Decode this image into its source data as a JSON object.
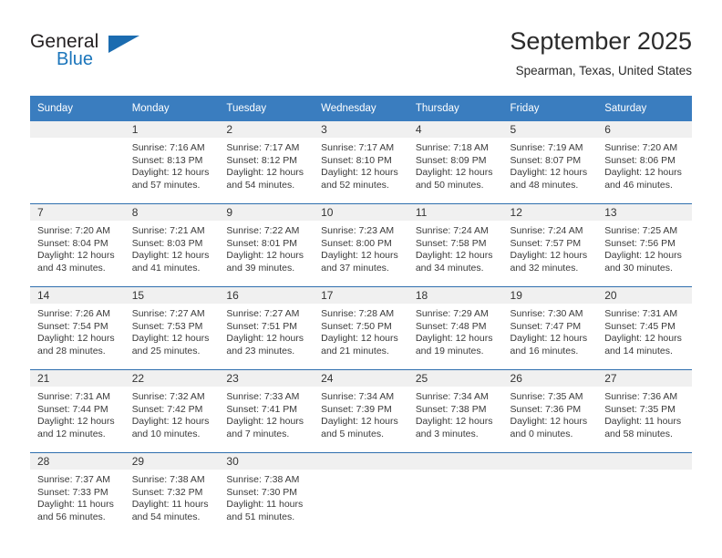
{
  "brand": {
    "name_part1": "General",
    "name_part2": "Blue",
    "accent_color": "#1b6cb0"
  },
  "header": {
    "title": "September 2025",
    "subtitle": "Spearman, Texas, United States"
  },
  "calendar": {
    "header_bg": "#3a7dbf",
    "daynum_bg": "#f0f0f0",
    "weekday_headers": [
      "Sunday",
      "Monday",
      "Tuesday",
      "Wednesday",
      "Thursday",
      "Friday",
      "Saturday"
    ],
    "weeks": [
      [
        {
          "day": "",
          "line1": "",
          "line2": "",
          "line3": "",
          "line4": ""
        },
        {
          "day": "1",
          "line1": "Sunrise: 7:16 AM",
          "line2": "Sunset: 8:13 PM",
          "line3": "Daylight: 12 hours",
          "line4": "and 57 minutes."
        },
        {
          "day": "2",
          "line1": "Sunrise: 7:17 AM",
          "line2": "Sunset: 8:12 PM",
          "line3": "Daylight: 12 hours",
          "line4": "and 54 minutes."
        },
        {
          "day": "3",
          "line1": "Sunrise: 7:17 AM",
          "line2": "Sunset: 8:10 PM",
          "line3": "Daylight: 12 hours",
          "line4": "and 52 minutes."
        },
        {
          "day": "4",
          "line1": "Sunrise: 7:18 AM",
          "line2": "Sunset: 8:09 PM",
          "line3": "Daylight: 12 hours",
          "line4": "and 50 minutes."
        },
        {
          "day": "5",
          "line1": "Sunrise: 7:19 AM",
          "line2": "Sunset: 8:07 PM",
          "line3": "Daylight: 12 hours",
          "line4": "and 48 minutes."
        },
        {
          "day": "6",
          "line1": "Sunrise: 7:20 AM",
          "line2": "Sunset: 8:06 PM",
          "line3": "Daylight: 12 hours",
          "line4": "and 46 minutes."
        }
      ],
      [
        {
          "day": "7",
          "line1": "Sunrise: 7:20 AM",
          "line2": "Sunset: 8:04 PM",
          "line3": "Daylight: 12 hours",
          "line4": "and 43 minutes."
        },
        {
          "day": "8",
          "line1": "Sunrise: 7:21 AM",
          "line2": "Sunset: 8:03 PM",
          "line3": "Daylight: 12 hours",
          "line4": "and 41 minutes."
        },
        {
          "day": "9",
          "line1": "Sunrise: 7:22 AM",
          "line2": "Sunset: 8:01 PM",
          "line3": "Daylight: 12 hours",
          "line4": "and 39 minutes."
        },
        {
          "day": "10",
          "line1": "Sunrise: 7:23 AM",
          "line2": "Sunset: 8:00 PM",
          "line3": "Daylight: 12 hours",
          "line4": "and 37 minutes."
        },
        {
          "day": "11",
          "line1": "Sunrise: 7:24 AM",
          "line2": "Sunset: 7:58 PM",
          "line3": "Daylight: 12 hours",
          "line4": "and 34 minutes."
        },
        {
          "day": "12",
          "line1": "Sunrise: 7:24 AM",
          "line2": "Sunset: 7:57 PM",
          "line3": "Daylight: 12 hours",
          "line4": "and 32 minutes."
        },
        {
          "day": "13",
          "line1": "Sunrise: 7:25 AM",
          "line2": "Sunset: 7:56 PM",
          "line3": "Daylight: 12 hours",
          "line4": "and 30 minutes."
        }
      ],
      [
        {
          "day": "14",
          "line1": "Sunrise: 7:26 AM",
          "line2": "Sunset: 7:54 PM",
          "line3": "Daylight: 12 hours",
          "line4": "and 28 minutes."
        },
        {
          "day": "15",
          "line1": "Sunrise: 7:27 AM",
          "line2": "Sunset: 7:53 PM",
          "line3": "Daylight: 12 hours",
          "line4": "and 25 minutes."
        },
        {
          "day": "16",
          "line1": "Sunrise: 7:27 AM",
          "line2": "Sunset: 7:51 PM",
          "line3": "Daylight: 12 hours",
          "line4": "and 23 minutes."
        },
        {
          "day": "17",
          "line1": "Sunrise: 7:28 AM",
          "line2": "Sunset: 7:50 PM",
          "line3": "Daylight: 12 hours",
          "line4": "and 21 minutes."
        },
        {
          "day": "18",
          "line1": "Sunrise: 7:29 AM",
          "line2": "Sunset: 7:48 PM",
          "line3": "Daylight: 12 hours",
          "line4": "and 19 minutes."
        },
        {
          "day": "19",
          "line1": "Sunrise: 7:30 AM",
          "line2": "Sunset: 7:47 PM",
          "line3": "Daylight: 12 hours",
          "line4": "and 16 minutes."
        },
        {
          "day": "20",
          "line1": "Sunrise: 7:31 AM",
          "line2": "Sunset: 7:45 PM",
          "line3": "Daylight: 12 hours",
          "line4": "and 14 minutes."
        }
      ],
      [
        {
          "day": "21",
          "line1": "Sunrise: 7:31 AM",
          "line2": "Sunset: 7:44 PM",
          "line3": "Daylight: 12 hours",
          "line4": "and 12 minutes."
        },
        {
          "day": "22",
          "line1": "Sunrise: 7:32 AM",
          "line2": "Sunset: 7:42 PM",
          "line3": "Daylight: 12 hours",
          "line4": "and 10 minutes."
        },
        {
          "day": "23",
          "line1": "Sunrise: 7:33 AM",
          "line2": "Sunset: 7:41 PM",
          "line3": "Daylight: 12 hours",
          "line4": "and 7 minutes."
        },
        {
          "day": "24",
          "line1": "Sunrise: 7:34 AM",
          "line2": "Sunset: 7:39 PM",
          "line3": "Daylight: 12 hours",
          "line4": "and 5 minutes."
        },
        {
          "day": "25",
          "line1": "Sunrise: 7:34 AM",
          "line2": "Sunset: 7:38 PM",
          "line3": "Daylight: 12 hours",
          "line4": "and 3 minutes."
        },
        {
          "day": "26",
          "line1": "Sunrise: 7:35 AM",
          "line2": "Sunset: 7:36 PM",
          "line3": "Daylight: 12 hours",
          "line4": "and 0 minutes."
        },
        {
          "day": "27",
          "line1": "Sunrise: 7:36 AM",
          "line2": "Sunset: 7:35 PM",
          "line3": "Daylight: 11 hours",
          "line4": "and 58 minutes."
        }
      ],
      [
        {
          "day": "28",
          "line1": "Sunrise: 7:37 AM",
          "line2": "Sunset: 7:33 PM",
          "line3": "Daylight: 11 hours",
          "line4": "and 56 minutes."
        },
        {
          "day": "29",
          "line1": "Sunrise: 7:38 AM",
          "line2": "Sunset: 7:32 PM",
          "line3": "Daylight: 11 hours",
          "line4": "and 54 minutes."
        },
        {
          "day": "30",
          "line1": "Sunrise: 7:38 AM",
          "line2": "Sunset: 7:30 PM",
          "line3": "Daylight: 11 hours",
          "line4": "and 51 minutes."
        },
        {
          "day": "",
          "line1": "",
          "line2": "",
          "line3": "",
          "line4": ""
        },
        {
          "day": "",
          "line1": "",
          "line2": "",
          "line3": "",
          "line4": ""
        },
        {
          "day": "",
          "line1": "",
          "line2": "",
          "line3": "",
          "line4": ""
        },
        {
          "day": "",
          "line1": "",
          "line2": "",
          "line3": "",
          "line4": ""
        }
      ]
    ]
  }
}
